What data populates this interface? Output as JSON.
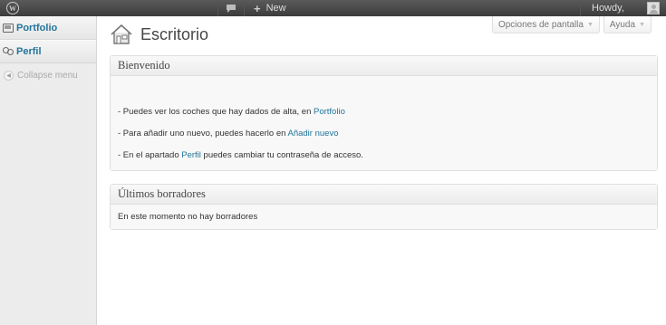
{
  "adminbar": {
    "logo_icon": "wordpress-logo-icon",
    "logo_letter": "W",
    "comments_icon": "speech-bubble-icon",
    "new_label": "New",
    "new_plus": "+",
    "howdy": "Howdy,"
  },
  "sidebar": {
    "items": [
      {
        "label": "Portfolio",
        "icon": "portfolio-icon"
      },
      {
        "label": "Perfil",
        "icon": "users-icon"
      }
    ],
    "collapse_label": "Collapse menu",
    "collapse_glyph": "◀"
  },
  "header": {
    "title": "Escritorio",
    "screen_options": "Opciones de pantalla",
    "help": "Ayuda",
    "caret": "▼"
  },
  "welcome": {
    "title": "Bienvenido",
    "lines": [
      {
        "prefix": "- Puedes ver los coches que hay dados de alta, en ",
        "link": "Portfolio",
        "suffix": ""
      },
      {
        "prefix": "- Para añadir uno nuevo, puedes hacerlo en ",
        "link": "Añadir nuevo",
        "suffix": ""
      },
      {
        "prefix": "- En el apartado ",
        "link": "Perfil",
        "suffix": " puedes cambiar tu contraseña de acceso."
      }
    ]
  },
  "drafts": {
    "title": "Últimos borradores",
    "empty_text": "En este momento no hay borradores"
  },
  "colors": {
    "link": "#21759b",
    "adminbar": "#464646",
    "sidebar": "#ececec"
  }
}
